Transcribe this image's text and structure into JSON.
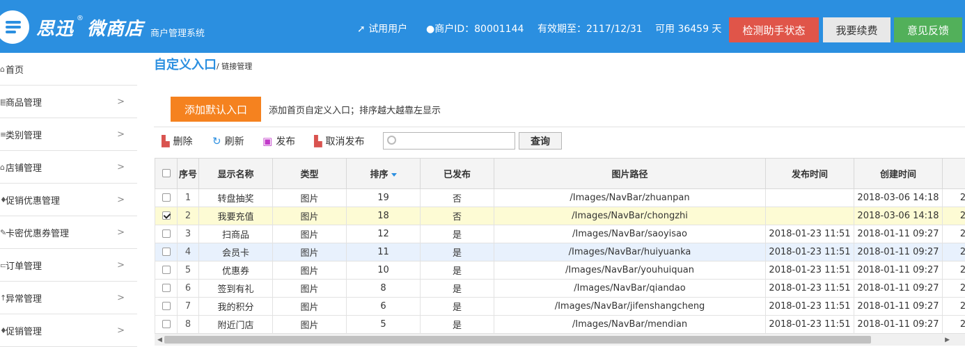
{
  "header": {
    "brand": "思迅",
    "brand_mark": "®",
    "brand_product": "微商店",
    "subtitle": "商户管理系统",
    "user_type": "试用用户",
    "merchant_id": "商户ID：80001144",
    "expiry": "有效期至：2117/12/31",
    "days_left": "可用 36459 天",
    "btn_check": "检测助手状态",
    "btn_renew": "我要续费",
    "btn_feedback": "意见反馈",
    "colors": {
      "bar": "#2b8fe0",
      "check": "#e05549",
      "renew": "#e8e8e8",
      "feedback": "#52b05a"
    }
  },
  "sidebar": {
    "items": [
      {
        "label": "首页",
        "icon": "home-icon",
        "glyph": "⌂",
        "chevron": ""
      },
      {
        "label": "商品管理",
        "icon": "goods-icon",
        "glyph": "▤",
        "chevron": ">"
      },
      {
        "label": "类别管理",
        "icon": "list-icon",
        "glyph": "≡",
        "chevron": ">"
      },
      {
        "label": "店铺管理",
        "icon": "bank-icon",
        "glyph": "⌂",
        "chevron": ">"
      },
      {
        "label": "促销优惠管理",
        "icon": "promo-icon",
        "glyph": "♦",
        "chevron": ">"
      },
      {
        "label": "卡密优惠券管理",
        "icon": "coupon-icon",
        "glyph": "✎",
        "chevron": ">"
      },
      {
        "label": "订单管理",
        "icon": "order-icon",
        "glyph": "▭",
        "chevron": ">"
      },
      {
        "label": "异常管理",
        "icon": "alert-icon",
        "glyph": "↑",
        "chevron": ">"
      },
      {
        "label": "促销管理",
        "icon": "sale-icon",
        "glyph": "♦",
        "chevron": ">"
      }
    ]
  },
  "breadcrumb": {
    "title": "自定义入口",
    "sub": "/ 链接管理"
  },
  "actions": {
    "add_default": "添加默认入口",
    "add_desc": "添加首页自定义入口；排序越大越靠左显示",
    "delete": "删除",
    "refresh": "刷新",
    "publish": "发布",
    "unpublish": "取消发布",
    "search_placeholder": "",
    "search_value": "",
    "query": "查询"
  },
  "table": {
    "columns": [
      "序号",
      "显示名称",
      "类型",
      "排序",
      "已发布",
      "图片路径",
      "发布时间",
      "创建时间"
    ],
    "sorted_column": "排序",
    "rows": [
      {
        "no": "1",
        "name": "转盘抽奖",
        "type": "图片",
        "sort": "19",
        "pub": "否",
        "path": "/Images/NavBar/zhuanpan",
        "pubtime": "",
        "ctime": "2018-03-06 14:18",
        "extra": "2",
        "checked": false
      },
      {
        "no": "2",
        "name": "我要充值",
        "type": "图片",
        "sort": "18",
        "pub": "否",
        "path": "/Images/NavBar/chongzhi",
        "pubtime": "",
        "ctime": "2018-03-06 14:18",
        "extra": "2",
        "checked": true
      },
      {
        "no": "3",
        "name": "扫商品",
        "type": "图片",
        "sort": "12",
        "pub": "是",
        "path": "/Images/NavBar/saoyisao",
        "pubtime": "2018-01-23 11:51",
        "ctime": "2018-01-11 09:27",
        "extra": "2",
        "checked": false
      },
      {
        "no": "4",
        "name": "会员卡",
        "type": "图片",
        "sort": "11",
        "pub": "是",
        "path": "/Images/NavBar/huiyuanka",
        "pubtime": "2018-01-23 11:51",
        "ctime": "2018-01-11 09:27",
        "extra": "2",
        "checked": false
      },
      {
        "no": "5",
        "name": "优惠券",
        "type": "图片",
        "sort": "10",
        "pub": "是",
        "path": "/Images/NavBar/youhuiquan",
        "pubtime": "2018-01-23 11:51",
        "ctime": "2018-01-11 09:27",
        "extra": "2",
        "checked": false
      },
      {
        "no": "6",
        "name": "签到有礼",
        "type": "图片",
        "sort": "8",
        "pub": "是",
        "path": "/Images/NavBar/qiandao",
        "pubtime": "2018-01-23 11:51",
        "ctime": "2018-01-11 09:27",
        "extra": "2",
        "checked": false
      },
      {
        "no": "7",
        "name": "我的积分",
        "type": "图片",
        "sort": "6",
        "pub": "是",
        "path": "/Images/NavBar/jifenshangcheng",
        "pubtime": "2018-01-23 11:51",
        "ctime": "2018-01-11 09:27",
        "extra": "2",
        "checked": false
      },
      {
        "no": "8",
        "name": "附近门店",
        "type": "图片",
        "sort": "5",
        "pub": "是",
        "path": "/Images/NavBar/mendian",
        "pubtime": "2018-01-23 11:51",
        "ctime": "2018-01-11 09:27",
        "extra": "2",
        "checked": false
      }
    ],
    "selected_row": 1,
    "hovered_row": 3
  }
}
